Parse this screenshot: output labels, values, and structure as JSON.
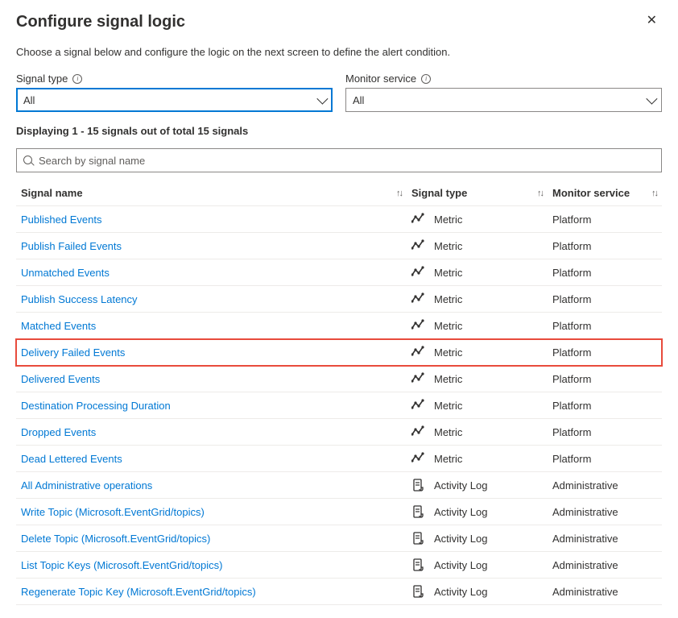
{
  "header": {
    "title": "Configure signal logic",
    "subtitle": "Choose a signal below and configure the logic on the next screen to define the alert condition."
  },
  "filters": {
    "signal_type": {
      "label": "Signal type",
      "value": "All"
    },
    "monitor_service": {
      "label": "Monitor service",
      "value": "All"
    }
  },
  "count_line": "Displaying 1 - 15 signals out of total 15 signals",
  "search": {
    "placeholder": "Search by signal name"
  },
  "columns": {
    "signal_name": "Signal name",
    "signal_type": "Signal type",
    "monitor_service": "Monitor service"
  },
  "rows": [
    {
      "name": "Published Events",
      "type": "Metric",
      "service": "Platform",
      "icon": "metric",
      "highlighted": false
    },
    {
      "name": "Publish Failed Events",
      "type": "Metric",
      "service": "Platform",
      "icon": "metric",
      "highlighted": false
    },
    {
      "name": "Unmatched Events",
      "type": "Metric",
      "service": "Platform",
      "icon": "metric",
      "highlighted": false
    },
    {
      "name": "Publish Success Latency",
      "type": "Metric",
      "service": "Platform",
      "icon": "metric",
      "highlighted": false
    },
    {
      "name": "Matched Events",
      "type": "Metric",
      "service": "Platform",
      "icon": "metric",
      "highlighted": false
    },
    {
      "name": "Delivery Failed Events",
      "type": "Metric",
      "service": "Platform",
      "icon": "metric",
      "highlighted": true
    },
    {
      "name": "Delivered Events",
      "type": "Metric",
      "service": "Platform",
      "icon": "metric",
      "highlighted": false
    },
    {
      "name": "Destination Processing Duration",
      "type": "Metric",
      "service": "Platform",
      "icon": "metric",
      "highlighted": false
    },
    {
      "name": "Dropped Events",
      "type": "Metric",
      "service": "Platform",
      "icon": "metric",
      "highlighted": false
    },
    {
      "name": "Dead Lettered Events",
      "type": "Metric",
      "service": "Platform",
      "icon": "metric",
      "highlighted": false
    },
    {
      "name": "All Administrative operations",
      "type": "Activity Log",
      "service": "Administrative",
      "icon": "log",
      "highlighted": false
    },
    {
      "name": "Write Topic (Microsoft.EventGrid/topics)",
      "type": "Activity Log",
      "service": "Administrative",
      "icon": "log",
      "highlighted": false
    },
    {
      "name": "Delete Topic (Microsoft.EventGrid/topics)",
      "type": "Activity Log",
      "service": "Administrative",
      "icon": "log",
      "highlighted": false
    },
    {
      "name": "List Topic Keys (Microsoft.EventGrid/topics)",
      "type": "Activity Log",
      "service": "Administrative",
      "icon": "log",
      "highlighted": false
    },
    {
      "name": "Regenerate Topic Key (Microsoft.EventGrid/topics)",
      "type": "Activity Log",
      "service": "Administrative",
      "icon": "log",
      "highlighted": false
    }
  ]
}
